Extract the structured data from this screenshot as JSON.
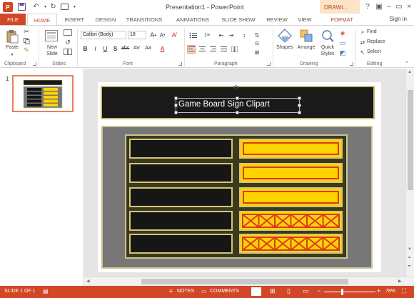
{
  "titlebar": {
    "title": "Presentation1 - PowerPoint",
    "context_tab": "DRAWI...",
    "help": "?",
    "minimize": "–",
    "restore": "▭",
    "close": "×"
  },
  "tabs": [
    {
      "label": "FILE"
    },
    {
      "label": "HOME"
    },
    {
      "label": "INSERT"
    },
    {
      "label": "DESIGN"
    },
    {
      "label": "TRANSITIONS"
    },
    {
      "label": "ANIMATIONS"
    },
    {
      "label": "SLIDE SHOW"
    },
    {
      "label": "REVIEW"
    },
    {
      "label": "VIEW"
    },
    {
      "label": "FORMAT"
    }
  ],
  "signin": "Sign in",
  "ribbon": {
    "clipboard": {
      "label": "Clipboard",
      "paste": "Paste"
    },
    "slides": {
      "label": "Slides",
      "new_slide_1": "New",
      "new_slide_2": "Slide"
    },
    "font": {
      "label": "Font",
      "font_name": "Calibri (Body)",
      "font_size": "18"
    },
    "paragraph": {
      "label": "Paragraph"
    },
    "drawing": {
      "label": "Drawing",
      "shapes": "Shapes",
      "arrange": "Arrange",
      "quick_1": "Quick",
      "quick_2": "Styles"
    },
    "editing": {
      "label": "Editing",
      "find": "Find",
      "replace": "Replace",
      "select": "Select"
    }
  },
  "slide_panel": {
    "slide_number": "1"
  },
  "slide": {
    "title": "Game Board Sign Clipart"
  },
  "statusbar": {
    "slide_info": "SLIDE 1 OF 1",
    "notes": "NOTES",
    "comments": "COMMENTS",
    "zoom": "78%"
  },
  "colors": {
    "accent": "#d24726",
    "board_yellow": "#ffd400",
    "board_red": "#d93a22",
    "board_gold": "#cfc490"
  },
  "board": {
    "rows": 5,
    "left_column": [
      "dark",
      "dark",
      "dark",
      "dark",
      "dark"
    ],
    "right_column": [
      "revealed",
      "revealed",
      "revealed",
      "strike",
      "strike"
    ]
  }
}
